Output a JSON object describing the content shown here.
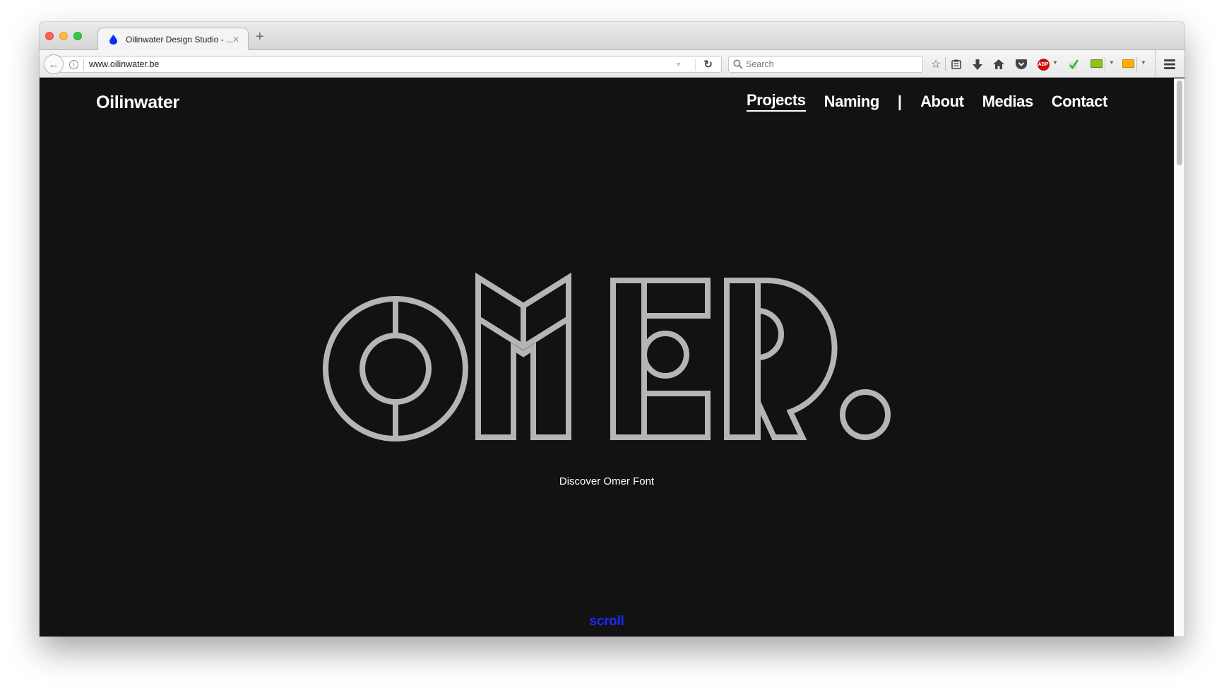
{
  "browser": {
    "tab": {
      "title": "Oilinwater Design Studio - ...",
      "favicon": "water-drop-icon",
      "favicon_color": "#0c2bff",
      "close_glyph": "✕"
    },
    "new_tab_glyph": "+",
    "url": "www.oilinwater.be",
    "search_placeholder": "Search",
    "toolbar_icons": [
      "bookmark-star-icon",
      "reading-list-icon",
      "download-icon",
      "home-icon",
      "pocket-icon",
      "adblock-plus-icon",
      "checkmark-extension-icon",
      "green-drive-icon",
      "orange-drive-icon",
      "hamburger-menu-icon"
    ],
    "abp_label": "ABP"
  },
  "site": {
    "logo": "Oilinwater",
    "nav": [
      {
        "label": "Projects",
        "active": true
      },
      {
        "label": "Naming",
        "active": false
      },
      {
        "label": "About",
        "active": false
      },
      {
        "label": "Medias",
        "active": false
      },
      {
        "label": "Contact",
        "active": false
      }
    ],
    "nav_divider": "|",
    "hero": {
      "wordmark": "OMER.",
      "cta": "Discover Omer Font",
      "logo_color": "#b5b5b5"
    },
    "scroll_label": "scroll",
    "scroll_color": "#1a2cff",
    "background_color": "#121212"
  }
}
